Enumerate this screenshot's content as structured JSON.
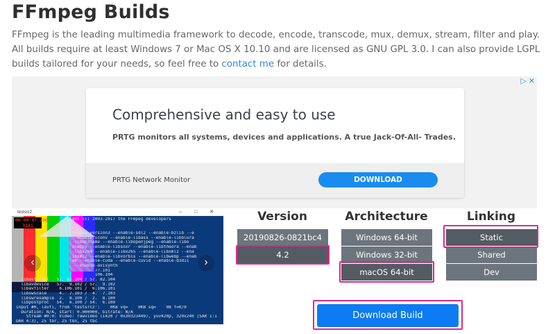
{
  "header": {
    "title": "FFmpeg Builds",
    "intro_text": "FFmpeg is the leading multimedia framework to decode, encode, transcode, mux, demux, stream, filter and play. All builds require at least Windows 7 or Mac OS X 10.10 and are licensed as GNU GPL 3.0. I can also provide LGPL builds tailored for your needs, so feel free to ",
    "contact_link": "contact me",
    "intro_tail": " for details."
  },
  "ad": {
    "choices_label": "▷",
    "choices_close": "✕",
    "headline": "Comprehensive and easy to use",
    "body": "PRTG monitors all systems, devices and applications. A true Jack-Of-All- Trades.",
    "brand": "PRTG Network Monitor",
    "cta": "DOWNLOAD"
  },
  "screenshot": {
    "window_title": "testsrc2",
    "window_controls": "– □ ✕",
    "timestamp_line1": "00:00:07.290",
    "timestamp_line2": "3181",
    "prev_icon": "‹",
    "next_icon": "›",
    "terminal_lines": [
      "                      ght (c) 2003-2017 the FFmpeg developers",
      "",
      "",
      "                      enable-version3 --enable-sdl2 --enable-bzlib --e",
      "                      --enable-iconv --enable-libass --enable-libblura",
      "                      -libmp3lame --enable-libopenjpeg --enable-libo",
      "                      snappy --enable-libsoxr --enable-libtheora --enab",
      "                      -libx264 --enable-libx265 --enable-libxml2 --ena",
      "                      ibxml2 --enable-libvorbis --enable-libwebp --enab",
      "                      ab --enable-cuda --enable-cuvid --enable-d3d11",
      "                      ---enable-avisynth",
      "                               77.101",
      "                               106.104",
      "  libavformat   57. 82.104 / 57. 82.104",
      "  libavdevice   57.  9.102 / 57.  9.102",
      "  libavfilter    6.106.101 /  6.106.101",
      "  libswscale     4.  7.103 /  4.  7.103",
      "  libswresample  2.  8.100 /  2.  8.100",
      "  libpostproc   54.  6.100 / 54.  6.100",
      "Input #0, lavfi, from 'testsrc2':    0KB vq=    0KB sq=    0B f=0/0",
      "  Duration: N/A, start: 0.000000, bitrate: N/A",
      "    Stream #0:0: Video: rawvideo (I420 / 0x30323449), yuv420p, 320x240 [SAR 1:1",
      "DAR 4:3], 25 tbr, 25 tbn, 25 tbc",
      "127.23 M-V: -0.023 fd= 219 aq=    0KB vq= 2927KB sq=    0B f=0/0"
    ]
  },
  "version": {
    "heading": "Version",
    "options": [
      "20190826-0821bc4",
      "4.2"
    ],
    "selected": "4.2"
  },
  "architecture": {
    "heading": "Architecture",
    "options": [
      "Windows 64-bit",
      "Windows 32-bit",
      "macOS 64-bit"
    ],
    "selected": "macOS 64-bit"
  },
  "linking": {
    "heading": "Linking",
    "options": [
      "Static",
      "Shared",
      "Dev"
    ],
    "selected": "Static"
  },
  "download_button": "Download Build",
  "colors": {
    "option_bg": "#6c757d",
    "option_selected_bg": "#545b62",
    "highlight": "#e0278a",
    "primary": "#0d7cf2",
    "link": "#2a8bd8"
  }
}
